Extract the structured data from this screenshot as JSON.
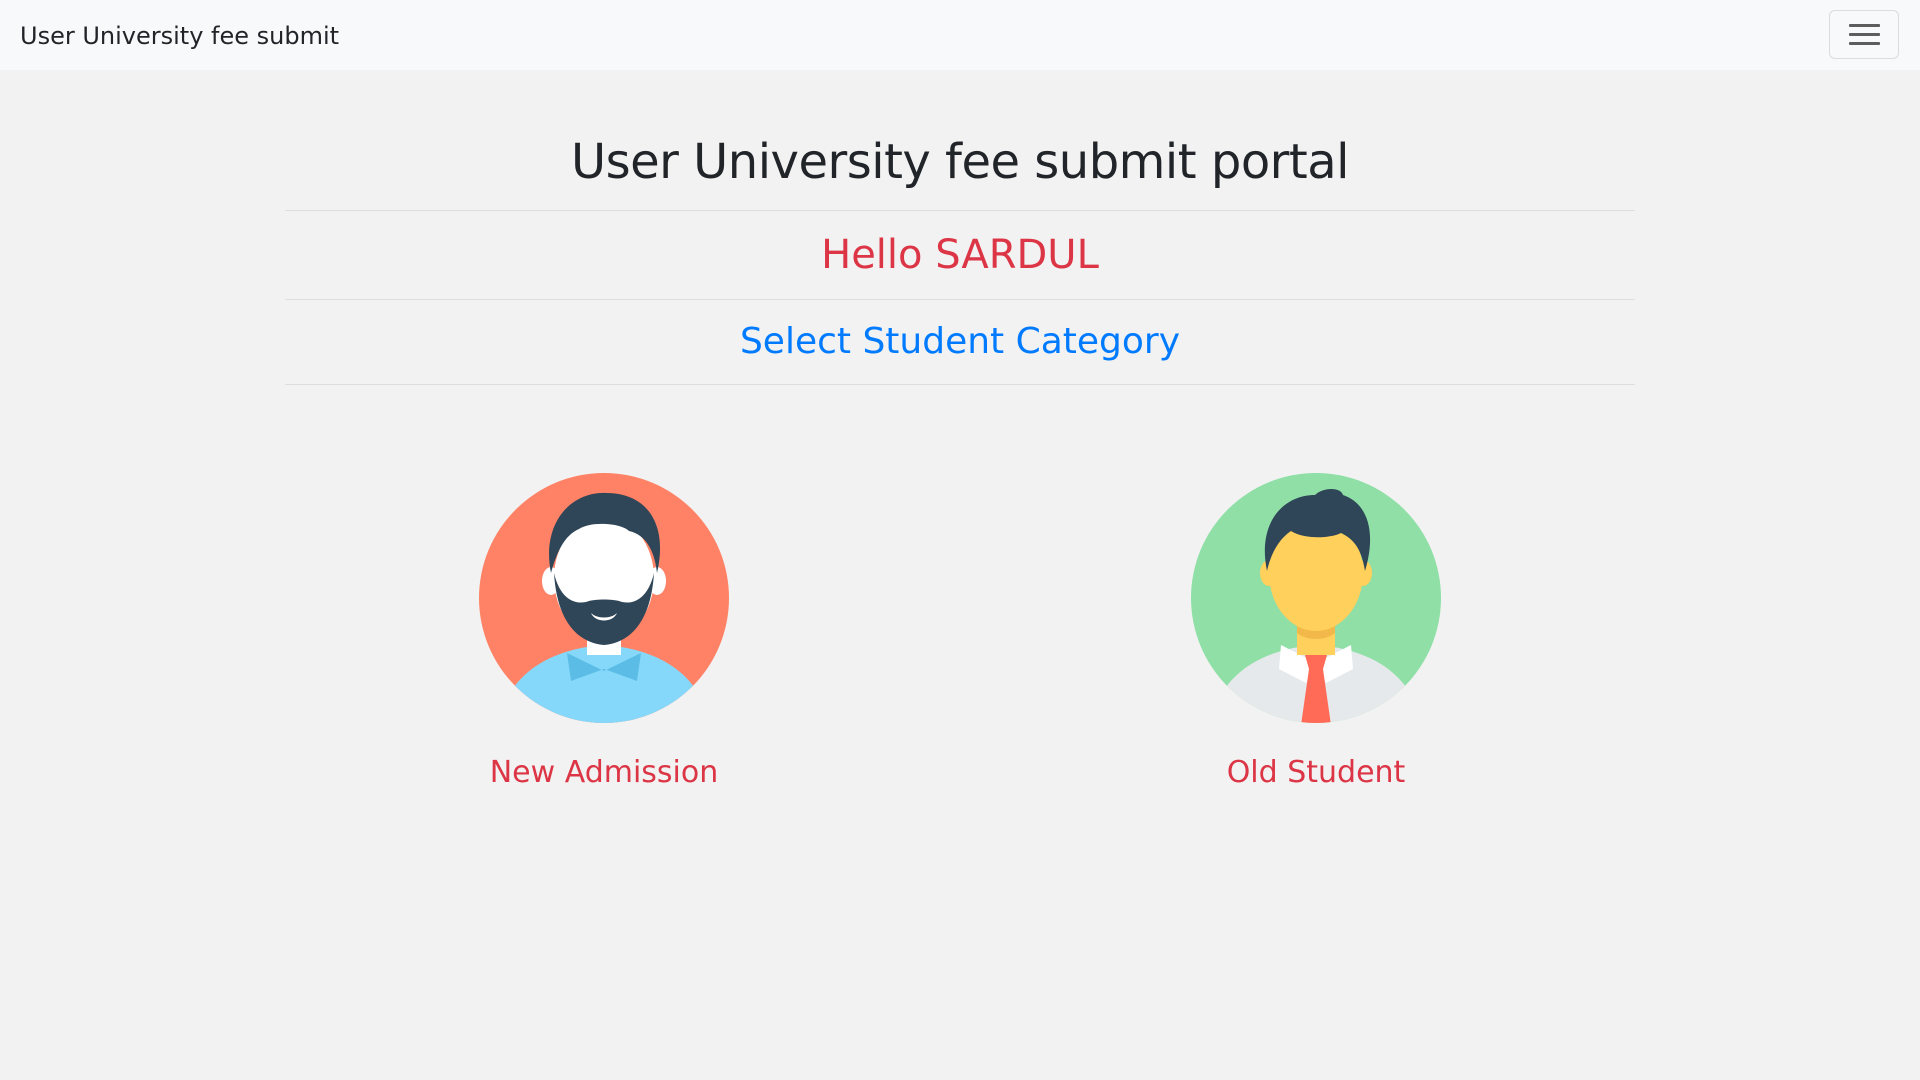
{
  "navbar": {
    "brand": "User University fee submit",
    "toggler_icon": "hamburger-menu-icon"
  },
  "main": {
    "title": "User University fee submit portal",
    "greeting": "Hello SARDUL",
    "subtitle": "Select Student Category"
  },
  "categories": [
    {
      "label": "New Admission",
      "icon": "bearded-man-avatar-icon",
      "bg_color": "#ff8266"
    },
    {
      "label": "Old Student",
      "icon": "student-with-tie-avatar-icon",
      "bg_color": "#8fdfa6"
    }
  ],
  "colors": {
    "accent_red": "#dc3545",
    "accent_blue": "#007bff",
    "page_bg": "#f2f2f2",
    "navbar_bg": "#f8f9fa"
  }
}
